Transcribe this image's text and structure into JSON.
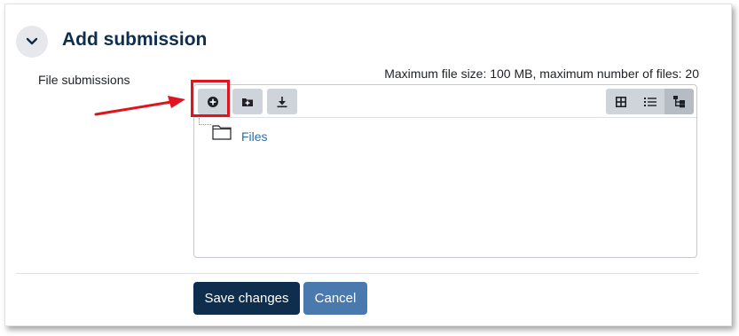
{
  "section": {
    "title": "Add submission",
    "collapse_icon": "chevron-down-icon"
  },
  "file_submissions": {
    "label": "File submissions",
    "limits": "Maximum file size: 100 MB, maximum number of files: 20",
    "toolbar": {
      "buttons": [
        {
          "icon": "add-file-icon"
        },
        {
          "icon": "create-folder-icon"
        },
        {
          "icon": "download-icon"
        }
      ],
      "views": [
        {
          "icon": "grid-view-icon"
        },
        {
          "icon": "list-view-icon"
        },
        {
          "icon": "tree-view-icon",
          "active": true
        }
      ]
    },
    "tree": {
      "root_folder": "Files"
    }
  },
  "actions": {
    "save_label": "Save changes",
    "cancel_label": "Cancel"
  },
  "colors": {
    "primary": "#0f2d4c",
    "secondary": "#4a79ad",
    "link": "#2c6ea8",
    "highlight": "#e0141e"
  }
}
